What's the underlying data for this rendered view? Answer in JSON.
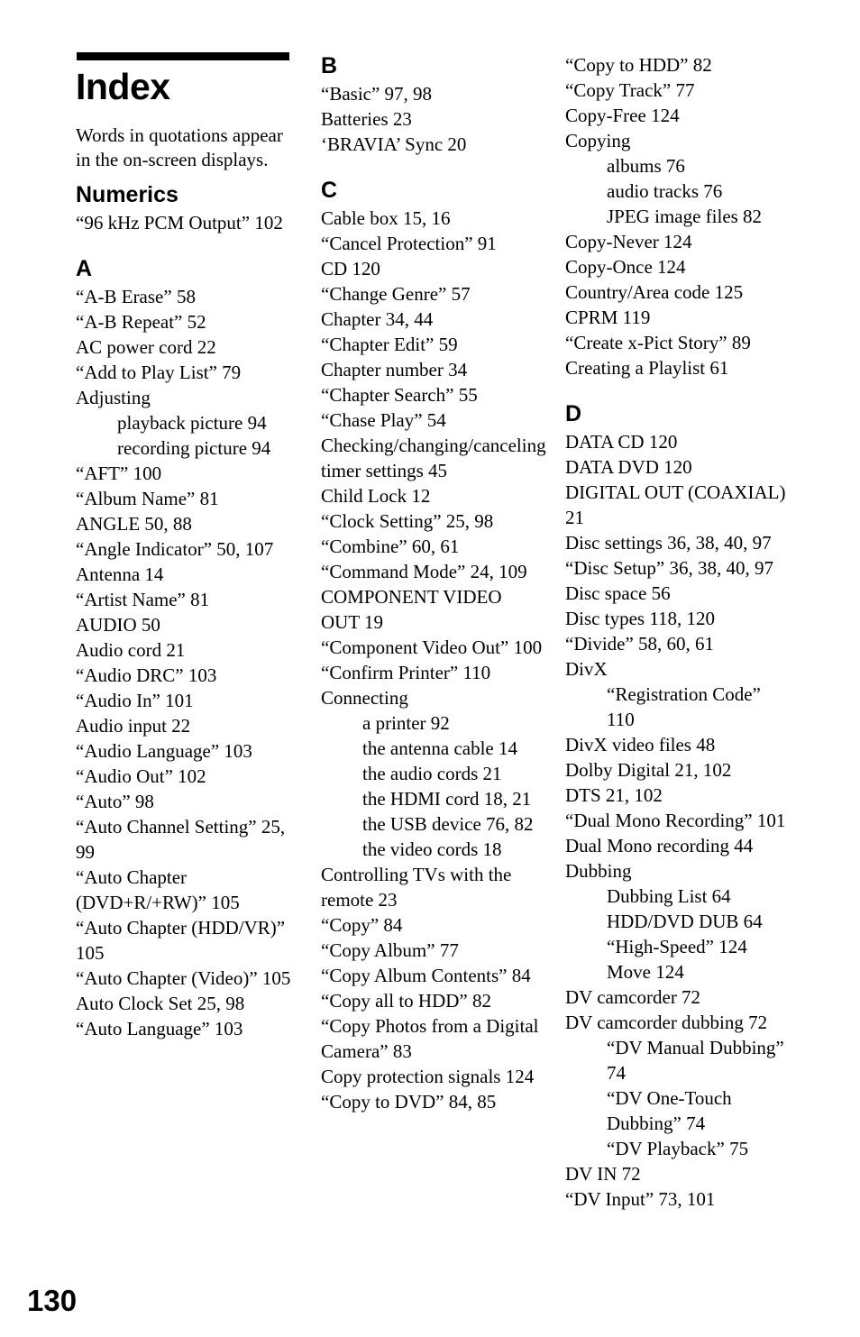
{
  "page": {
    "folio": "130",
    "title": "Index",
    "intro": "Words in quotations appear in the on-screen displays."
  },
  "columns": [
    {
      "id": "column-1",
      "sections": [
        {
          "letter": "Numerics",
          "heading_style": "word",
          "entries": [
            {
              "level": 0,
              "text": "“96 kHz PCM Output” 102"
            }
          ]
        },
        {
          "letter": "A",
          "heading_style": "letter",
          "entries": [
            {
              "level": 0,
              "text": "“A-B Erase” 58"
            },
            {
              "level": 0,
              "text": "“A-B Repeat” 52"
            },
            {
              "level": 0,
              "text": "AC power cord 22"
            },
            {
              "level": 0,
              "text": "“Add to Play List” 79"
            },
            {
              "level": 0,
              "text": "Adjusting"
            },
            {
              "level": 1,
              "text": "playback picture 94"
            },
            {
              "level": 1,
              "text": "recording picture 94"
            },
            {
              "level": 0,
              "text": "“AFT” 100"
            },
            {
              "level": 0,
              "text": "“Album Name” 81"
            },
            {
              "level": 0,
              "text": "ANGLE 50, 88"
            },
            {
              "level": 0,
              "text": "“Angle Indicator” 50, 107"
            },
            {
              "level": 0,
              "text": "Antenna 14"
            },
            {
              "level": 0,
              "text": "“Artist Name” 81"
            },
            {
              "level": 0,
              "text": "AUDIO 50"
            },
            {
              "level": 0,
              "text": "Audio cord 21"
            },
            {
              "level": 0,
              "text": "“Audio DRC” 103"
            },
            {
              "level": 0,
              "text": "“Audio In” 101"
            },
            {
              "level": 0,
              "text": "Audio input 22"
            },
            {
              "level": 0,
              "text": "“Audio Language” 103"
            },
            {
              "level": 0,
              "text": "“Audio Out” 102"
            },
            {
              "level": 0,
              "text": "“Auto” 98"
            },
            {
              "level": 0,
              "text": "“Auto Channel Setting” 25, 99"
            },
            {
              "level": 0,
              "text": "“Auto Chapter (DVD+R/+RW)” 105"
            },
            {
              "level": 0,
              "text": "“Auto Chapter (HDD/VR)” 105"
            },
            {
              "level": 0,
              "text": "“Auto Chapter (Video)” 105"
            },
            {
              "level": 0,
              "text": "Auto Clock Set 25, 98"
            },
            {
              "level": 0,
              "text": "“Auto Language” 103"
            }
          ]
        }
      ]
    },
    {
      "id": "column-2",
      "sections": [
        {
          "letter": "B",
          "heading_style": "letter",
          "entries": [
            {
              "level": 0,
              "text": "“Basic” 97, 98"
            },
            {
              "level": 0,
              "text": "Batteries 23"
            },
            {
              "level": 0,
              "text": "‘BRAVIA’ Sync 20"
            }
          ]
        },
        {
          "letter": "C",
          "heading_style": "letter",
          "entries": [
            {
              "level": 0,
              "text": "Cable box 15, 16"
            },
            {
              "level": 0,
              "text": "“Cancel Protection” 91"
            },
            {
              "level": 0,
              "text": "CD 120"
            },
            {
              "level": 0,
              "text": "“Change Genre” 57"
            },
            {
              "level": 0,
              "text": "Chapter 34, 44"
            },
            {
              "level": 0,
              "text": "“Chapter Edit” 59"
            },
            {
              "level": 0,
              "text": "Chapter number 34"
            },
            {
              "level": 0,
              "text": "“Chapter Search” 55"
            },
            {
              "level": 0,
              "text": "“Chase Play” 54"
            },
            {
              "level": 0,
              "text": "Checking/changing/canceling timer settings 45"
            },
            {
              "level": 0,
              "text": "Child Lock 12"
            },
            {
              "level": 0,
              "text": "“Clock Setting” 25, 98"
            },
            {
              "level": 0,
              "text": "“Combine” 60, 61"
            },
            {
              "level": 0,
              "text": "“Command Mode” 24, 109"
            },
            {
              "level": 0,
              "text": "COMPONENT VIDEO OUT 19"
            },
            {
              "level": 0,
              "text": "“Component Video Out” 100"
            },
            {
              "level": 0,
              "text": "“Confirm Printer” 110"
            },
            {
              "level": 0,
              "text": "Connecting"
            },
            {
              "level": 1,
              "text": "a printer 92"
            },
            {
              "level": 1,
              "text": "the antenna cable 14"
            },
            {
              "level": 1,
              "text": "the audio cords 21"
            },
            {
              "level": 1,
              "text": "the HDMI cord 18, 21"
            },
            {
              "level": 1,
              "text": "the USB device 76, 82"
            },
            {
              "level": 1,
              "text": "the video cords 18"
            },
            {
              "level": 0,
              "text": "Controlling TVs with the remote 23"
            },
            {
              "level": 0,
              "text": "“Copy” 84"
            },
            {
              "level": 0,
              "text": "“Copy Album” 77"
            },
            {
              "level": 0,
              "text": "“Copy Album Contents” 84"
            },
            {
              "level": 0,
              "text": "“Copy all to HDD” 82"
            },
            {
              "level": 0,
              "text": "“Copy Photos from a Digital Camera” 83"
            },
            {
              "level": 0,
              "text": "Copy protection signals 124"
            },
            {
              "level": 0,
              "text": "“Copy to DVD” 84, 85"
            }
          ]
        }
      ]
    },
    {
      "id": "column-3",
      "sections": [
        {
          "letter": "",
          "heading_style": "none",
          "entries": [
            {
              "level": 0,
              "text": "“Copy to HDD” 82"
            },
            {
              "level": 0,
              "text": "“Copy Track” 77"
            },
            {
              "level": 0,
              "text": "Copy-Free 124"
            },
            {
              "level": 0,
              "text": "Copying"
            },
            {
              "level": 1,
              "text": "albums 76"
            },
            {
              "level": 1,
              "text": "audio tracks 76"
            },
            {
              "level": 1,
              "text": "JPEG image files 82"
            },
            {
              "level": 0,
              "text": "Copy-Never 124"
            },
            {
              "level": 0,
              "text": "Copy-Once 124"
            },
            {
              "level": 0,
              "text": "Country/Area code 125"
            },
            {
              "level": 0,
              "text": "CPRM 119"
            },
            {
              "level": 0,
              "text": "“Create x-Pict Story” 89"
            },
            {
              "level": 0,
              "text": "Creating a Playlist 61"
            }
          ]
        },
        {
          "letter": "D",
          "heading_style": "letter",
          "entries": [
            {
              "level": 0,
              "text": "DATA CD 120"
            },
            {
              "level": 0,
              "text": "DATA DVD 120"
            },
            {
              "level": 0,
              "text": "DIGITAL OUT (COAXIAL) 21"
            },
            {
              "level": 0,
              "text": "Disc settings 36, 38, 40, 97"
            },
            {
              "level": 0,
              "text": "“Disc Setup” 36, 38, 40, 97"
            },
            {
              "level": 0,
              "text": "Disc space 56"
            },
            {
              "level": 0,
              "text": "Disc types 118, 120"
            },
            {
              "level": 0,
              "text": "“Divide” 58, 60, 61"
            },
            {
              "level": 0,
              "text": "DivX"
            },
            {
              "level": 1,
              "text": "“Registration Code” 110"
            },
            {
              "level": 0,
              "text": "DivX video files 48"
            },
            {
              "level": 0,
              "text": "Dolby Digital 21, 102"
            },
            {
              "level": 0,
              "text": "DTS 21, 102"
            },
            {
              "level": 0,
              "text": "“Dual Mono Recording” 101"
            },
            {
              "level": 0,
              "text": "Dual Mono recording 44"
            },
            {
              "level": 0,
              "text": "Dubbing"
            },
            {
              "level": 1,
              "text": "Dubbing List 64"
            },
            {
              "level": 1,
              "text": "HDD/DVD DUB 64"
            },
            {
              "level": 1,
              "text": "“High-Speed” 124"
            },
            {
              "level": 1,
              "text": "Move 124"
            },
            {
              "level": 0,
              "text": "DV camcorder 72"
            },
            {
              "level": 0,
              "text": "DV camcorder dubbing 72"
            },
            {
              "level": 1,
              "text": "“DV Manual Dubbing” 74"
            },
            {
              "level": 1,
              "text": "“DV One-Touch Dubbing” 74"
            },
            {
              "level": 1,
              "text": "“DV Playback” 75"
            },
            {
              "level": 0,
              "text": "DV IN 72"
            },
            {
              "level": 0,
              "text": "“DV Input” 73, 101"
            }
          ]
        }
      ]
    }
  ]
}
